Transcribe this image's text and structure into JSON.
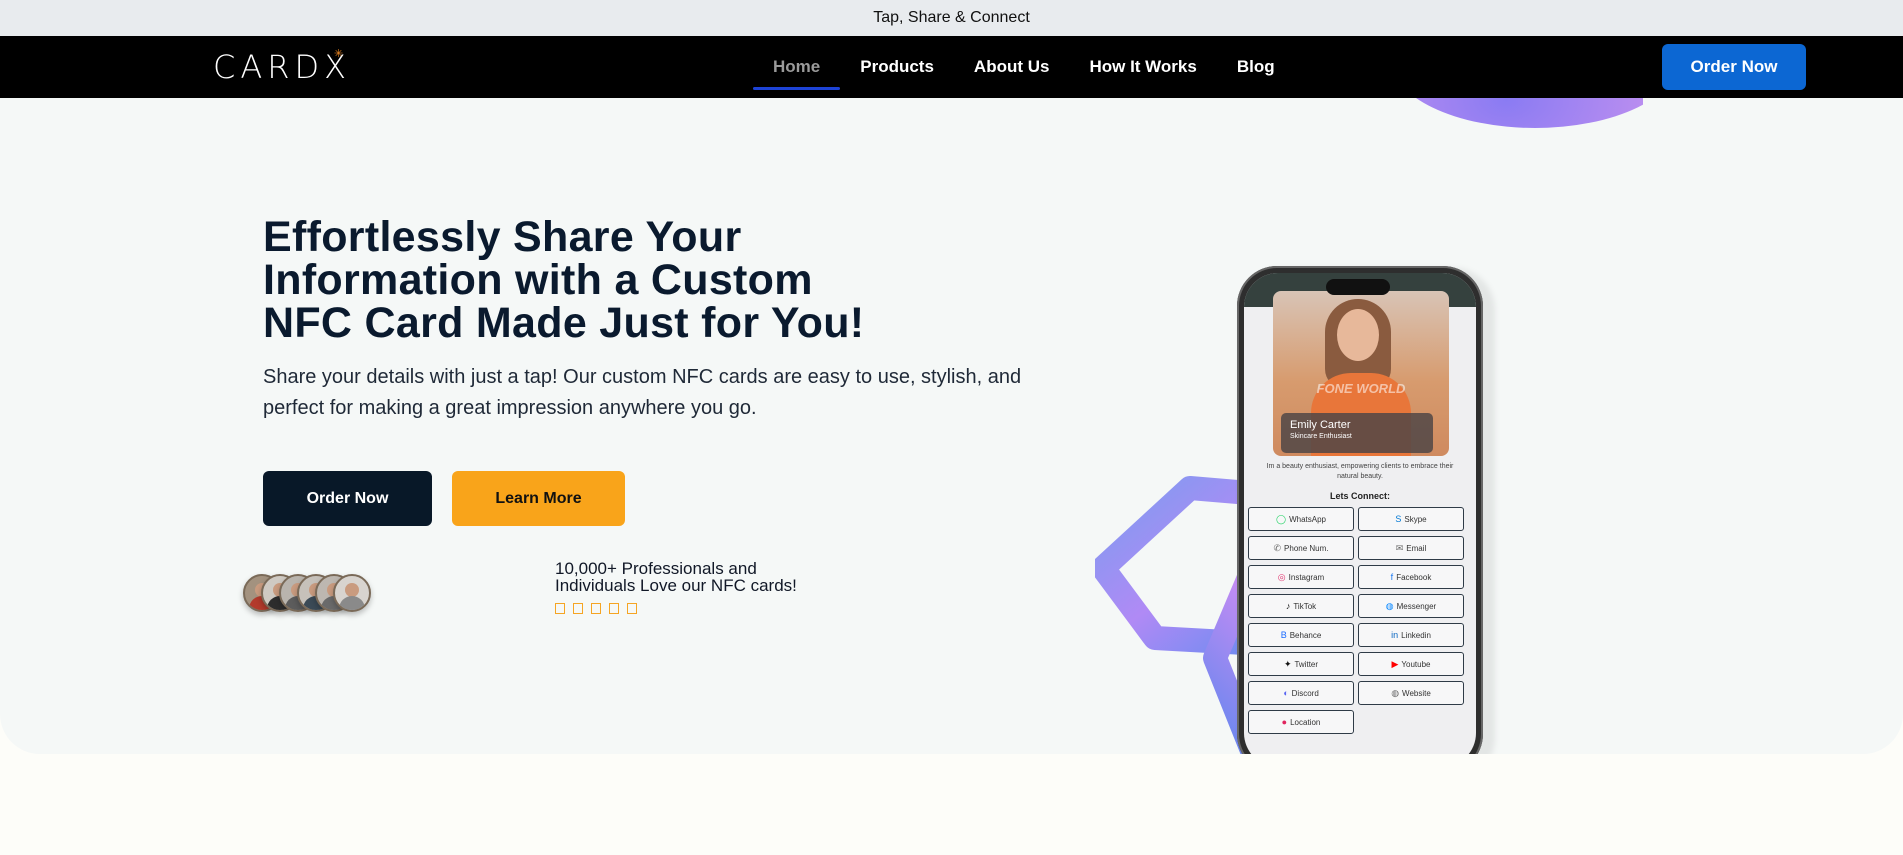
{
  "topbar": {
    "text": "Tap, Share & Connect"
  },
  "nav": {
    "logo": "CARDX",
    "links": [
      {
        "label": "Home",
        "active": true
      },
      {
        "label": "Products"
      },
      {
        "label": "About Us"
      },
      {
        "label": "How It Works"
      },
      {
        "label": "Blog"
      }
    ],
    "order_button": "Order Now"
  },
  "hero": {
    "headline": [
      "Effortlessly Share Your",
      "Information with a Custom",
      "NFC Card Made Just for You!"
    ],
    "subtext": "Share your details with just a tap! Our custom NFC cards are easy to use, stylish, and perfect for making a great impression anywhere you go.",
    "primary_button": "Order Now",
    "secondary_button": "Learn More",
    "proof_line_1": "10,000+ Professionals and",
    "proof_line_2": "Individuals Love our NFC cards!",
    "rating_stars": 5
  },
  "phone": {
    "watermark": "FONE WORLD",
    "name": "Emily Carter",
    "role": "Skincare Enthusiast",
    "bio": "Im a beauty enthusiast, empowering clients to embrace their natural beauty.",
    "connect_title": "Lets Connect:",
    "links": [
      {
        "label": "WhatsApp",
        "icon": "whatsapp-icon",
        "glyph": "◯",
        "color": "#25d366"
      },
      {
        "label": "Skype",
        "icon": "skype-icon",
        "glyph": "S",
        "color": "#0078d4"
      },
      {
        "label": "Phone Num.",
        "icon": "phone-icon",
        "glyph": "✆",
        "color": "#666666"
      },
      {
        "label": "Email",
        "icon": "email-icon",
        "glyph": "✉",
        "color": "#666666"
      },
      {
        "label": "Instagram",
        "icon": "instagram-icon",
        "glyph": "◎",
        "color": "#e1306c"
      },
      {
        "label": "Facebook",
        "icon": "facebook-icon",
        "glyph": "f",
        "color": "#1877f2"
      },
      {
        "label": "TikTok",
        "icon": "tiktok-icon",
        "glyph": "♪",
        "color": "#111111"
      },
      {
        "label": "Messenger",
        "icon": "messenger-icon",
        "glyph": "◍",
        "color": "#0084ff"
      },
      {
        "label": "Behance",
        "icon": "behance-icon",
        "glyph": "B",
        "color": "#1769ff"
      },
      {
        "label": "Linkedin",
        "icon": "linkedin-icon",
        "glyph": "in",
        "color": "#0a66c2"
      },
      {
        "label": "Twitter",
        "icon": "twitter-icon",
        "glyph": "✦",
        "color": "#111111"
      },
      {
        "label": "Youtube",
        "icon": "youtube-icon",
        "glyph": "▶",
        "color": "#ff0000"
      },
      {
        "label": "Discord",
        "icon": "discord-icon",
        "glyph": "◐",
        "color": "#5865f2"
      },
      {
        "label": "Website",
        "icon": "globe-icon",
        "glyph": "◍",
        "color": "#666666"
      },
      {
        "label": "Location",
        "icon": "location-pin-icon",
        "glyph": "●",
        "color": "#e0245e"
      }
    ]
  },
  "colors": {
    "nav_background": "#000000",
    "primary_blue": "#0c67d3",
    "dark_button": "#081828",
    "accent_orange": "#f9a41a",
    "hero_background": "#f5f8f7"
  }
}
